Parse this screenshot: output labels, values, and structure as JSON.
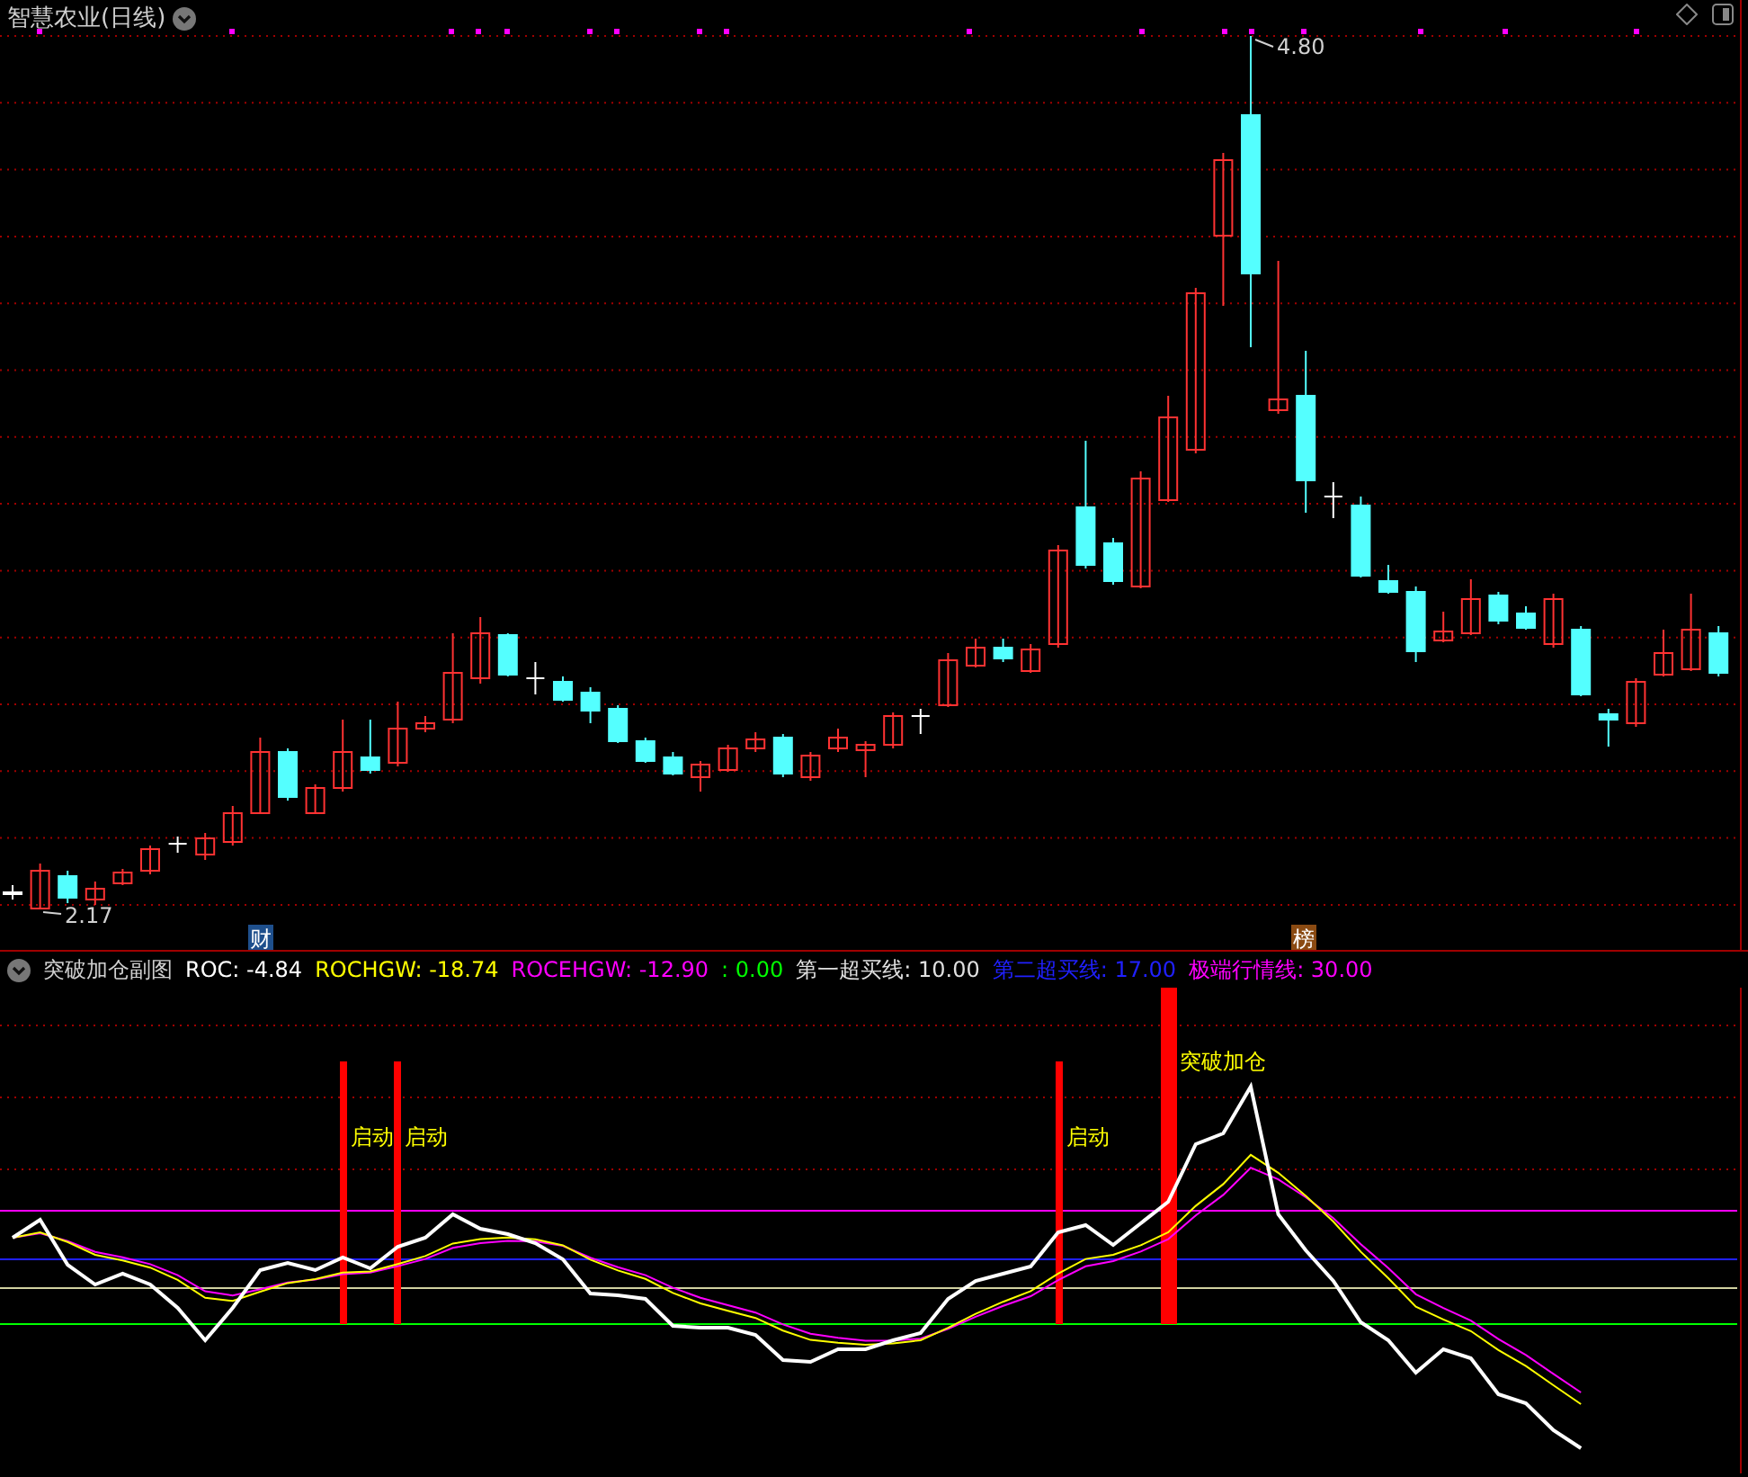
{
  "title": "智慧农业(日线)",
  "price_high_label": "4.80",
  "price_low_label": "2.17",
  "markers": [
    {
      "text": "财",
      "color": "#1e4f8c"
    },
    {
      "text": "榜",
      "color": "#8a4a12"
    }
  ],
  "indicator": {
    "name": "突破加仓副图",
    "values": [
      {
        "text": "ROC: -4.84",
        "color": "#ffffff"
      },
      {
        "text": "ROCHGW: -18.74",
        "color": "#ffff00"
      },
      {
        "text": "ROCEHGW: -12.90",
        "color": "#ff00ff"
      },
      {
        "text": ": 0.00",
        "color": "#00ff00"
      },
      {
        "text": "第一超买线: 10.00",
        "color": "#e0e0e0"
      },
      {
        "text": "第二超买线: 17.00",
        "color": "#2020ff"
      },
      {
        "text": "极端行情线: 30.00",
        "color": "#ff00ff"
      }
    ],
    "signals": [
      {
        "label": "启动",
        "kind": "start"
      },
      {
        "label": "启动",
        "kind": "start"
      },
      {
        "label": "启动",
        "kind": "start"
      },
      {
        "label": "突破加仓",
        "kind": "breakout"
      }
    ]
  }
}
